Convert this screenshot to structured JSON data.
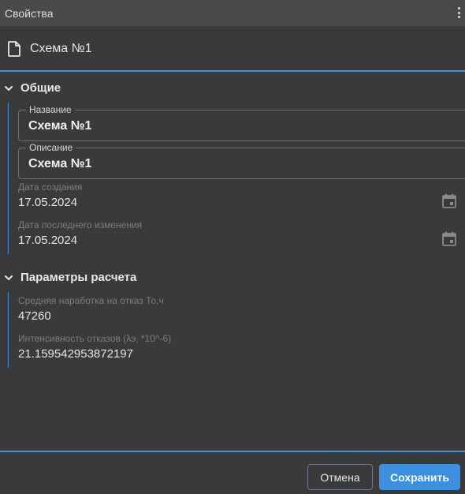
{
  "window": {
    "title": "Свойства",
    "menu_icon": "kebab-menu-icon"
  },
  "document": {
    "name": "Схема №1",
    "icon": "file-icon"
  },
  "accent_color": "#3d8fe0",
  "sections": {
    "general": {
      "title": "Общие",
      "fields": {
        "name": {
          "label": "Название",
          "value": "Схема №1"
        },
        "description": {
          "label": "Описание",
          "value": "Схема №1"
        },
        "created": {
          "label": "Дата создания",
          "value": "17.05.2024"
        },
        "modified": {
          "label": "Дата последнего изменения",
          "value": "17.05.2024"
        }
      }
    },
    "calc": {
      "title": "Параметры расчета",
      "fields": {
        "mtbf": {
          "label": "Средняя наработка на отказ То,ч",
          "value": "47260"
        },
        "failure_rate": {
          "label": "Интенсивность отказов (λэ, *10^-6)",
          "value": "21.159542953872197"
        }
      }
    }
  },
  "footer": {
    "cancel_label": "Отмена",
    "save_label": "Сохранить"
  }
}
